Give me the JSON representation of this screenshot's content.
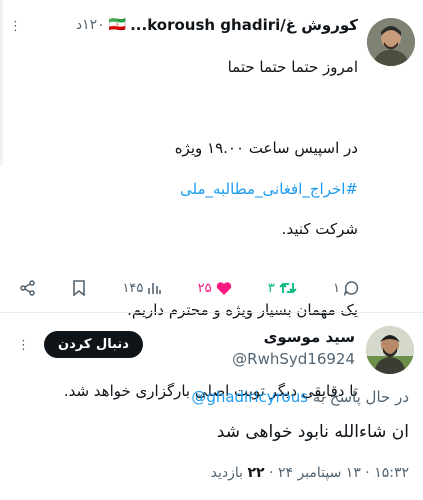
{
  "tweet": {
    "author_name": "کوروش غ/koroush ghadiri...",
    "flag": "🇮🇷",
    "time": "۱۲۰د",
    "line1": "امروز حتما حتما حتما",
    "line2": "در اسپیس ساعت ۱۹.۰۰ ویژه",
    "hashtag": "#اخراج_افغانی_مطالبه_ملی",
    "line3": "شرکت کنید.",
    "line4": "یک مهمان بسیار ویژه و محترم داریم.",
    "line5": "تا دقایقی دیگر تویت اصلی بارگزاری خواهد شد.",
    "replies": "۱",
    "retweets": "۳",
    "likes": "۲۵",
    "views": "۱۴۵"
  },
  "reply": {
    "author_name": "سید موسوی",
    "handle": "@RwhSyd16924",
    "follow_label": "دنبال کردن",
    "replying_to_label": "در حال پاسخ به",
    "replying_to_handle": "@ghadiricyrous",
    "text": "ان شاءالله نابود خواهی شد",
    "timestamp": "۱۵:۳۲ · ۱۳ سپتامبر ۲۴ ·",
    "views_count": "۲۲",
    "views_label": "بازدید"
  },
  "colors": {
    "link": "#1d9bf0",
    "like": "#f91880",
    "retweet": "#00ba7c",
    "text": "#0f1419",
    "muted": "#536471"
  }
}
